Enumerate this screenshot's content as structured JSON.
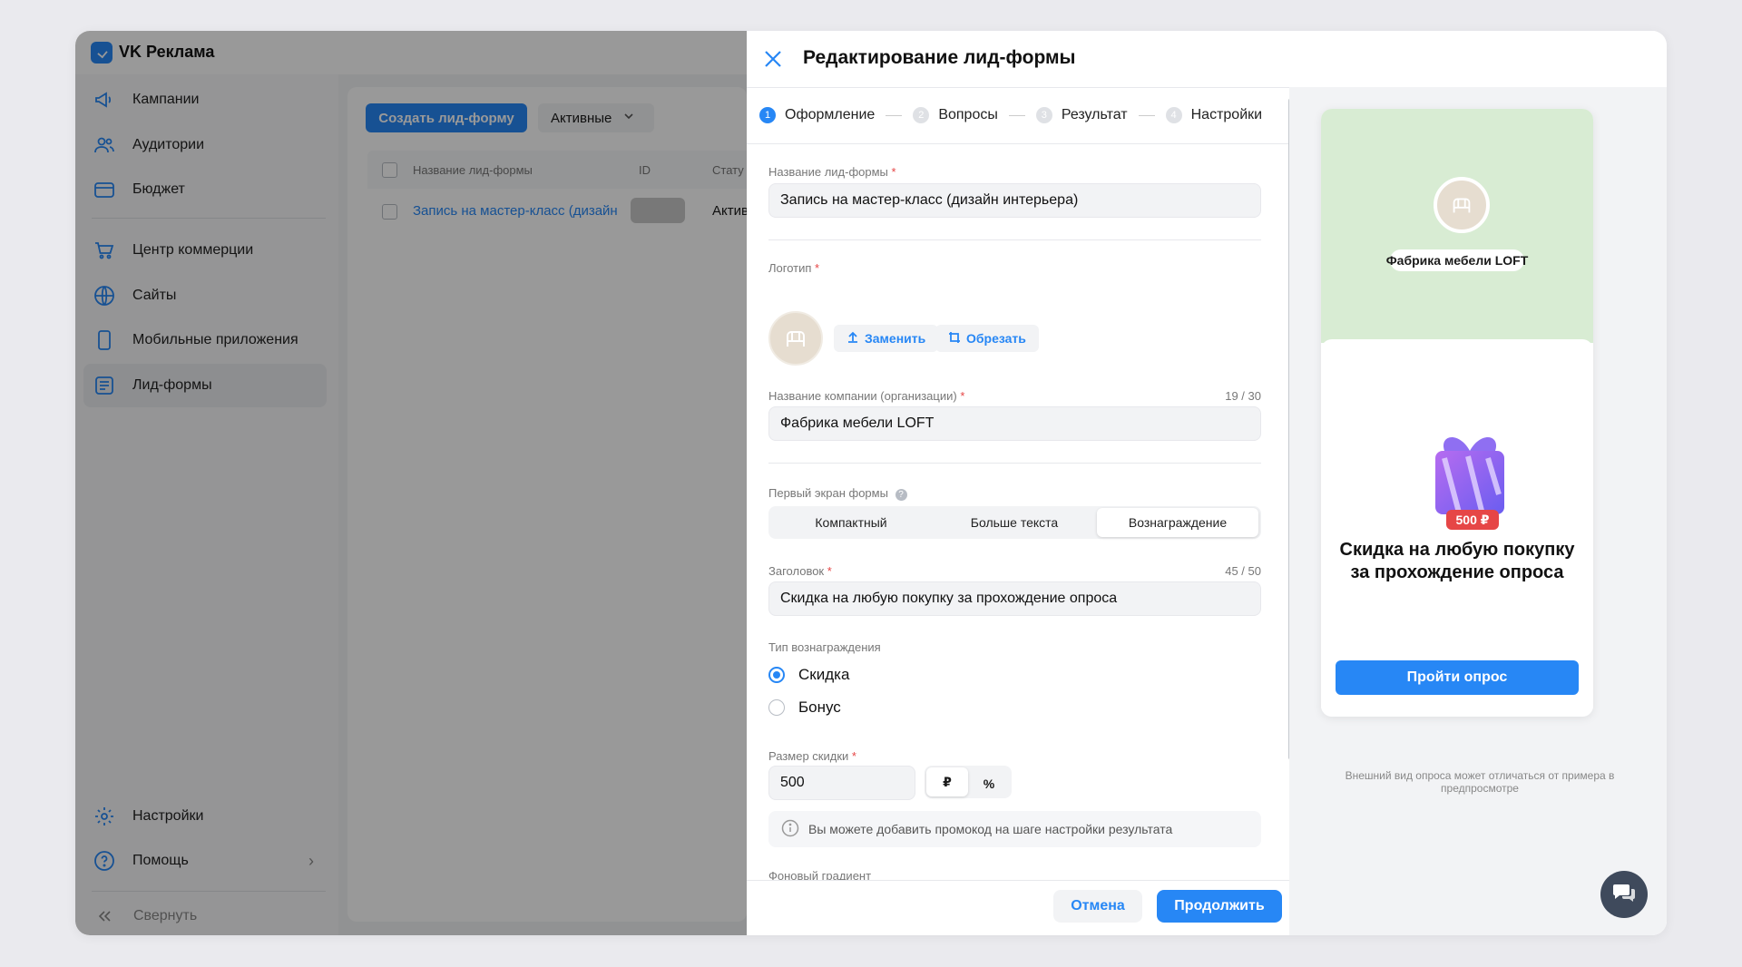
{
  "app": {
    "title": "VK Реклама"
  },
  "sidebar": {
    "items": [
      {
        "label": "Кампании",
        "icon": "megaphone-icon"
      },
      {
        "label": "Аудитории",
        "icon": "users-icon"
      },
      {
        "label": "Бюджет",
        "icon": "wallet-icon"
      },
      {
        "label": "Центр коммерции",
        "icon": "cart-icon"
      },
      {
        "label": "Сайты",
        "icon": "globe-icon"
      },
      {
        "label": "Мобильные приложения",
        "icon": "phone-icon"
      },
      {
        "label": "Лид-формы",
        "icon": "list-icon",
        "active": true
      }
    ],
    "settings": "Настройки",
    "help": "Помощь",
    "collapse": "Свернуть"
  },
  "list": {
    "create_button": "Создать лид-форму",
    "filter": "Активные",
    "columns": [
      "Название лид-формы",
      "ID",
      "Стату"
    ],
    "row": {
      "name": "Запись на мастер-класс (дизайн",
      "status": "Актив"
    }
  },
  "modal": {
    "title": "Редактирование лид-формы",
    "steps": [
      {
        "n": "1",
        "label": "Оформление",
        "active": true
      },
      {
        "n": "2",
        "label": "Вопросы"
      },
      {
        "n": "3",
        "label": "Результат"
      },
      {
        "n": "4",
        "label": "Настройки"
      }
    ],
    "form_name_label": "Название лид-формы",
    "form_name_value": "Запись на мастер-класс (дизайн интерьера)",
    "logo_label": "Логотип",
    "replace_button": "Заменить",
    "crop_button": "Обрезать",
    "company_label": "Название компании (организации)",
    "company_counter": "19 / 30",
    "company_value": "Фабрика мебели LOFT",
    "first_screen_label": "Первый экран формы",
    "first_screen_options": [
      "Компактный",
      "Больше текста",
      "Вознаграждение"
    ],
    "first_screen_selected": "Вознаграждение",
    "heading_label": "Заголовок",
    "heading_counter": "45 / 50",
    "heading_value": "Скидка на любую покупку за прохождение опроса",
    "reward_type_label": "Тип вознаграждения",
    "reward_options": [
      "Скидка",
      "Бонус"
    ],
    "reward_selected": "Скидка",
    "discount_label": "Размер скидки",
    "discount_value": "500",
    "currency_options": [
      "₽",
      "%"
    ],
    "currency_selected": "₽",
    "info_text": "Вы можете добавить промокод на шаге настройки результата",
    "gradient_label": "Фоновый градиент",
    "cancel_button": "Отмена",
    "continue_button": "Продолжить"
  },
  "preview": {
    "company": "Фабрика мебели LOFT",
    "badge": "500 ₽",
    "title": "Скидка на любую покупку за прохождение опроса",
    "button": "Пройти опрос",
    "note": "Внешний вид опроса может отличаться от примера в предпросмотре",
    "top_color": "#d8ecd3"
  },
  "colors": {
    "accent": "#2787f5",
    "danger": "#e64646"
  }
}
